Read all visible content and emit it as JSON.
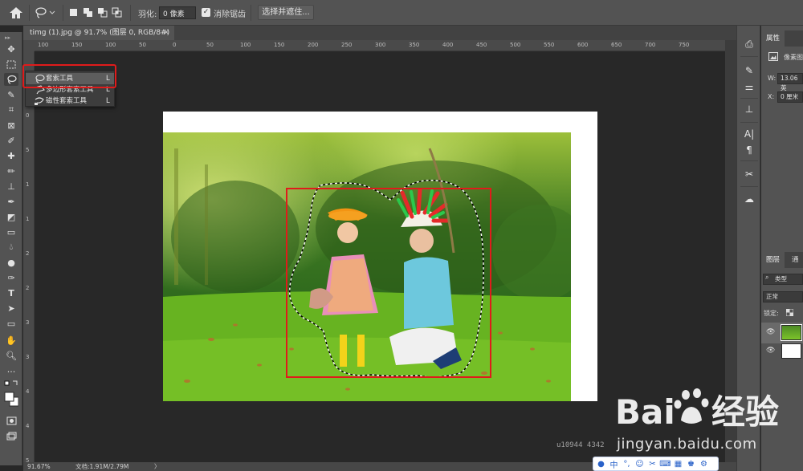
{
  "options_bar": {
    "feather_label": "羽化:",
    "feather_value": "0 像素",
    "antialias_label": "消除锯齿",
    "antialias_checked": true,
    "select_mask_label": "选择并遮住..."
  },
  "document_tab": {
    "title": "timg (1).jpg @ 91.7% (图层 0, RGB/8#) *",
    "close": "×"
  },
  "ruler_h": [
    "100",
    "150",
    "100",
    "50",
    "0",
    "50",
    "100",
    "150",
    "200",
    "250",
    "300",
    "350",
    "400",
    "450",
    "500",
    "550",
    "600",
    "650",
    "700",
    "750"
  ],
  "ruler_v": [
    "0",
    "5",
    "1",
    "1",
    "2",
    "2",
    "3",
    "3",
    "4",
    "4",
    "5"
  ],
  "lasso_flyout": {
    "items": [
      {
        "label": "套索工具",
        "shortcut": "L",
        "selected": true,
        "icon": "lasso-icon"
      },
      {
        "label": "多边形套索工具",
        "shortcut": "L",
        "selected": false,
        "icon": "polygonal-lasso-icon"
      },
      {
        "label": "磁性套索工具",
        "shortcut": "L",
        "selected": false,
        "icon": "magnetic-lasso-icon"
      }
    ]
  },
  "status_bar": {
    "zoom": "91.67%",
    "doc_size": "文档:1.91M/2.79M",
    "arrow": "〉"
  },
  "properties_panel": {
    "tab": "属性",
    "pixel_layer": "像素图",
    "w_label": "W:",
    "w_value": "13.06 英",
    "x_label": "X:",
    "x_value": "0 厘米"
  },
  "layers_panel": {
    "tabs": [
      "图层",
      "通"
    ],
    "filter_value": "类型",
    "blend_mode": "正常",
    "lock_label": "锁定:"
  },
  "watermark": {
    "url": "jingyan.baidu.com",
    "image_id": "u10944 4342"
  },
  "colors": {
    "highlight": "#e01b1b",
    "panel_bg": "#535353",
    "canvas_bg": "#282828"
  }
}
